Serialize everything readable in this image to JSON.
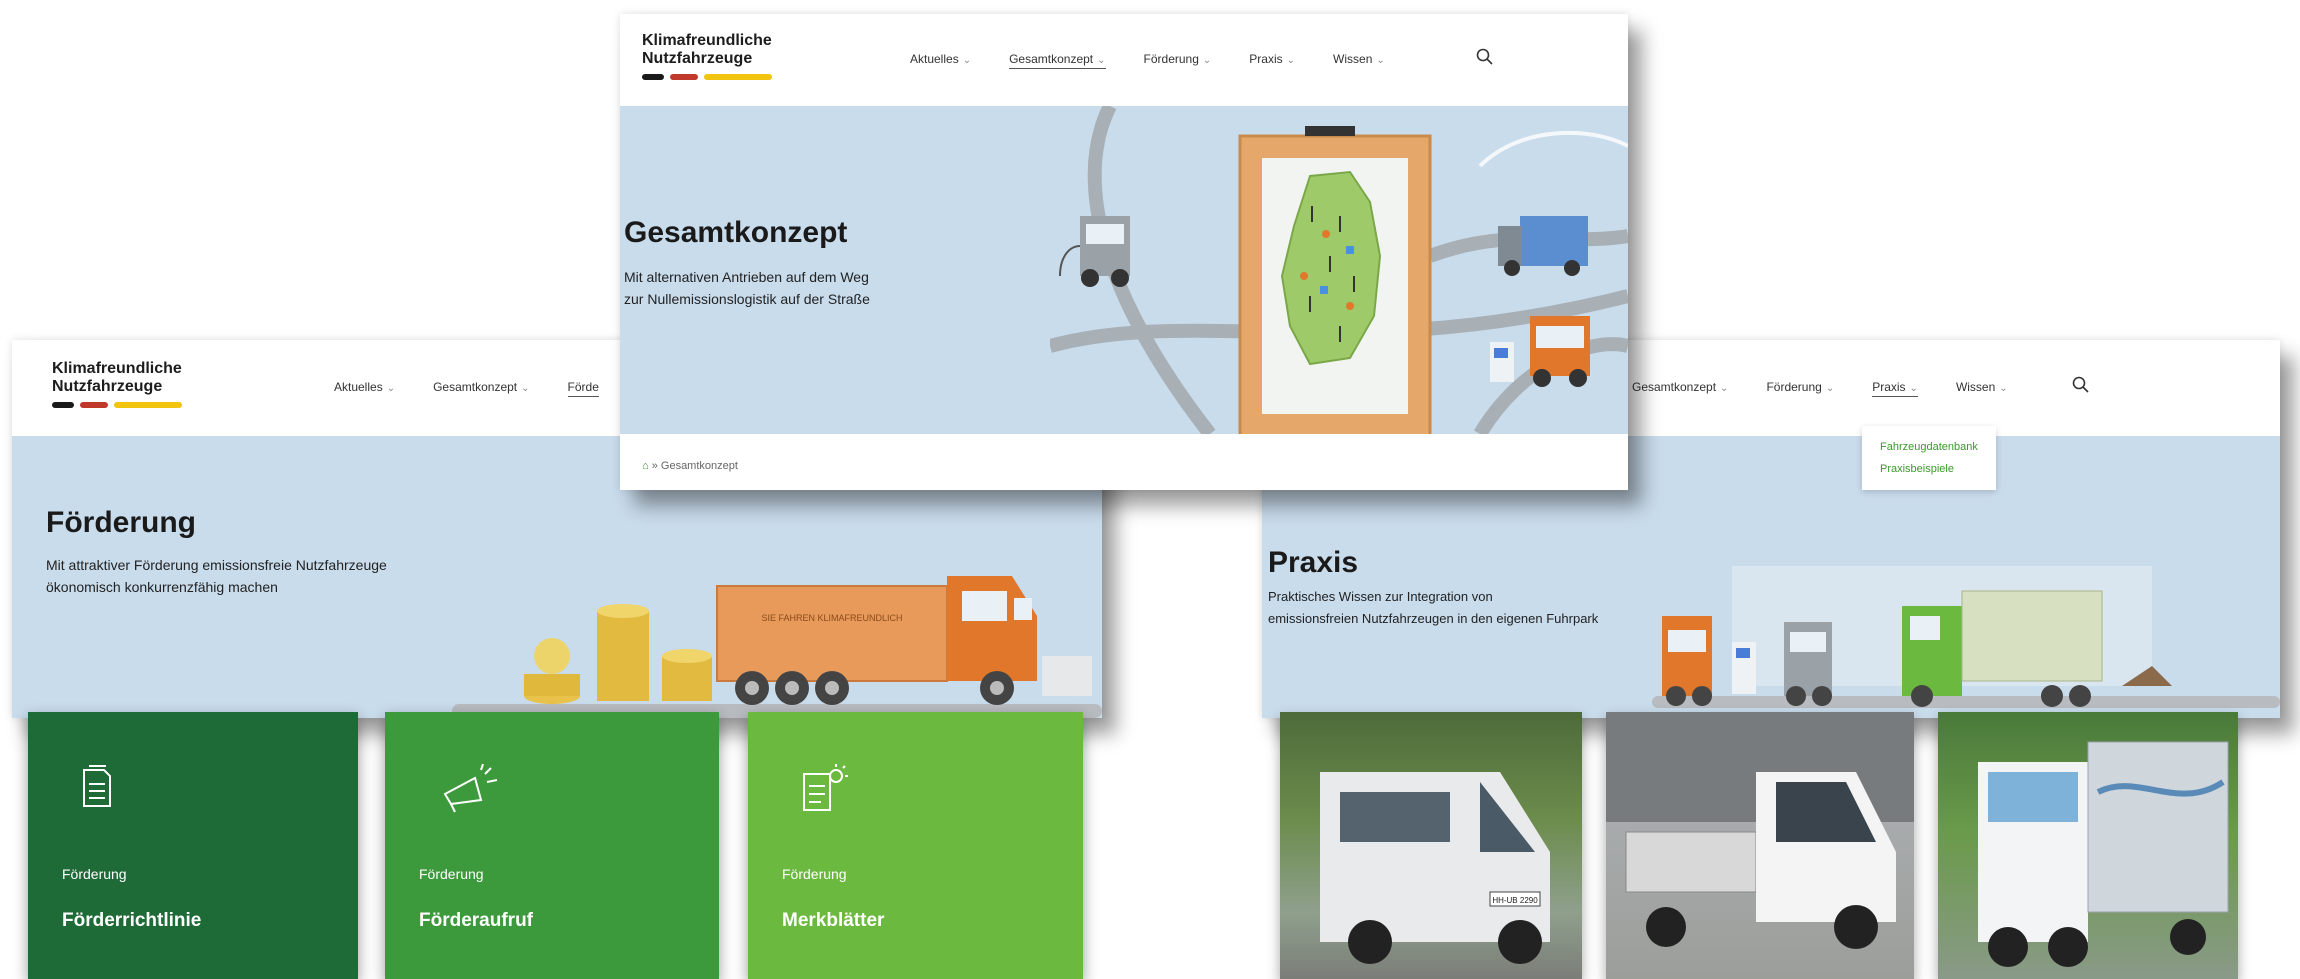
{
  "logo": {
    "line1": "Klimafreundliche",
    "line2": "Nutzfahrzeuge",
    "colors": [
      "#1a1a1a",
      "#c0392b",
      "#f1c40f"
    ]
  },
  "foerderung_page": {
    "nav": {
      "aktuelles": "Aktuelles",
      "gesamtkonzept": "Gesamtkonzept",
      "foerderung_partial": "Förde"
    },
    "hero": {
      "title": "Förderung",
      "sub1": "Mit attraktiver Förderung emissionsfreie Nutzfahrzeuge",
      "sub2": "ökonomisch konkurrenzfähig machen",
      "truck_text": "SIE FAHREN KLIMAFREUNDLICH"
    },
    "tiles": [
      {
        "kicker": "Förderung",
        "title": "Förderrichtlinie",
        "color": "#1e6b37",
        "icon": "document-icon"
      },
      {
        "kicker": "Förderung",
        "title": "Förderaufruf",
        "color": "#3d9a3c",
        "icon": "megaphone-icon"
      },
      {
        "kicker": "Förderung",
        "title": "Merkblätter",
        "color": "#6cb93f",
        "icon": "document-lightbulb-icon"
      }
    ]
  },
  "gesamtkonzept_page": {
    "nav": {
      "aktuelles": "Aktuelles",
      "gesamtkonzept": "Gesamtkonzept",
      "foerderung": "Förderung",
      "praxis": "Praxis",
      "wissen": "Wissen"
    },
    "hero": {
      "title": "Gesamtkonzept",
      "sub1": "Mit alternativen Antrieben auf dem Weg",
      "sub2": "zur Nullemissionslogistik auf der Straße"
    },
    "breadcrumb": "» Gesamtkonzept"
  },
  "praxis_page": {
    "nav": {
      "gesamtkonzept": "Gesamtkonzept",
      "foerderung": "Förderung",
      "praxis": "Praxis",
      "wissen": "Wissen"
    },
    "dropdown": [
      "Fahrzeugdatenbank",
      "Praxisbeispiele"
    ],
    "hero": {
      "title": "Praxis",
      "sub1": "Praktisches Wissen zur Integration von",
      "sub2": "emissionsfreien Nutzfahrzeugen in den eigenen Fuhrpark"
    },
    "photos": [
      {
        "label": "van-photo",
        "plate": "HH-UB 2290"
      },
      {
        "label": "pickup-photo",
        "plate": ""
      },
      {
        "label": "truck-photo",
        "plate": ""
      }
    ]
  },
  "colors": {
    "hero_bg": "#c9dcec",
    "accent_green": "#3a9a2a",
    "truck_orange": "#e0772b"
  }
}
